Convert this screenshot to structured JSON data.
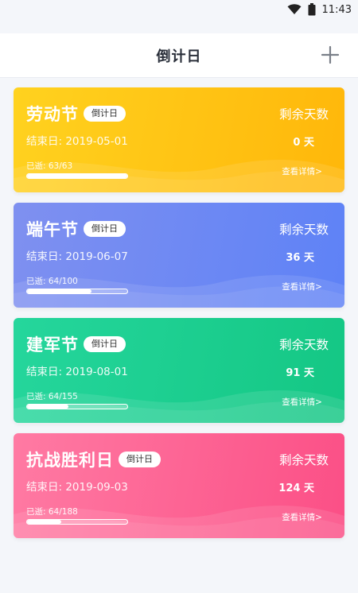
{
  "status_bar": {
    "time": "11:43",
    "icons": [
      "wifi-icon",
      "battery-icon"
    ]
  },
  "app_bar": {
    "title": "倒计日",
    "add_icon": "plus-icon"
  },
  "cards": [
    {
      "name": "劳动节",
      "tag": "倒计日",
      "end_date": "结束日: 2019-05-01",
      "progress_label": "已逝:  63/63",
      "progress_fraction": 1.0,
      "remain_label": "剩余天数",
      "remain_value": "0 天",
      "detail_link": "查看详情>",
      "colors": {
        "from": "#ffd21f",
        "to": "#ffb70a"
      }
    },
    {
      "name": "端午节",
      "tag": "倒计日",
      "end_date": "结束日: 2019-06-07",
      "progress_label": "已逝:  64/100",
      "progress_fraction": 0.64,
      "remain_label": "剩余天数",
      "remain_value": "36 天",
      "detail_link": "查看详情>",
      "colors": {
        "from": "#7f90f0",
        "to": "#5e82f6"
      }
    },
    {
      "name": "建军节",
      "tag": "倒计日",
      "end_date": "结束日: 2019-08-01",
      "progress_label": "已逝:  64/155",
      "progress_fraction": 0.413,
      "remain_label": "剩余天数",
      "remain_value": "91 天",
      "detail_link": "查看详情>",
      "colors": {
        "from": "#25d69c",
        "to": "#14c784"
      }
    },
    {
      "name": "抗战胜利日",
      "tag": "倒计日",
      "end_date": "结束日: 2019-09-03",
      "progress_label": "已逝:  64/188",
      "progress_fraction": 0.34,
      "remain_label": "剩余天数",
      "remain_value": "124 天",
      "detail_link": "查看详情>",
      "colors": {
        "from": "#ff7aa3",
        "to": "#fb4f86"
      }
    }
  ]
}
